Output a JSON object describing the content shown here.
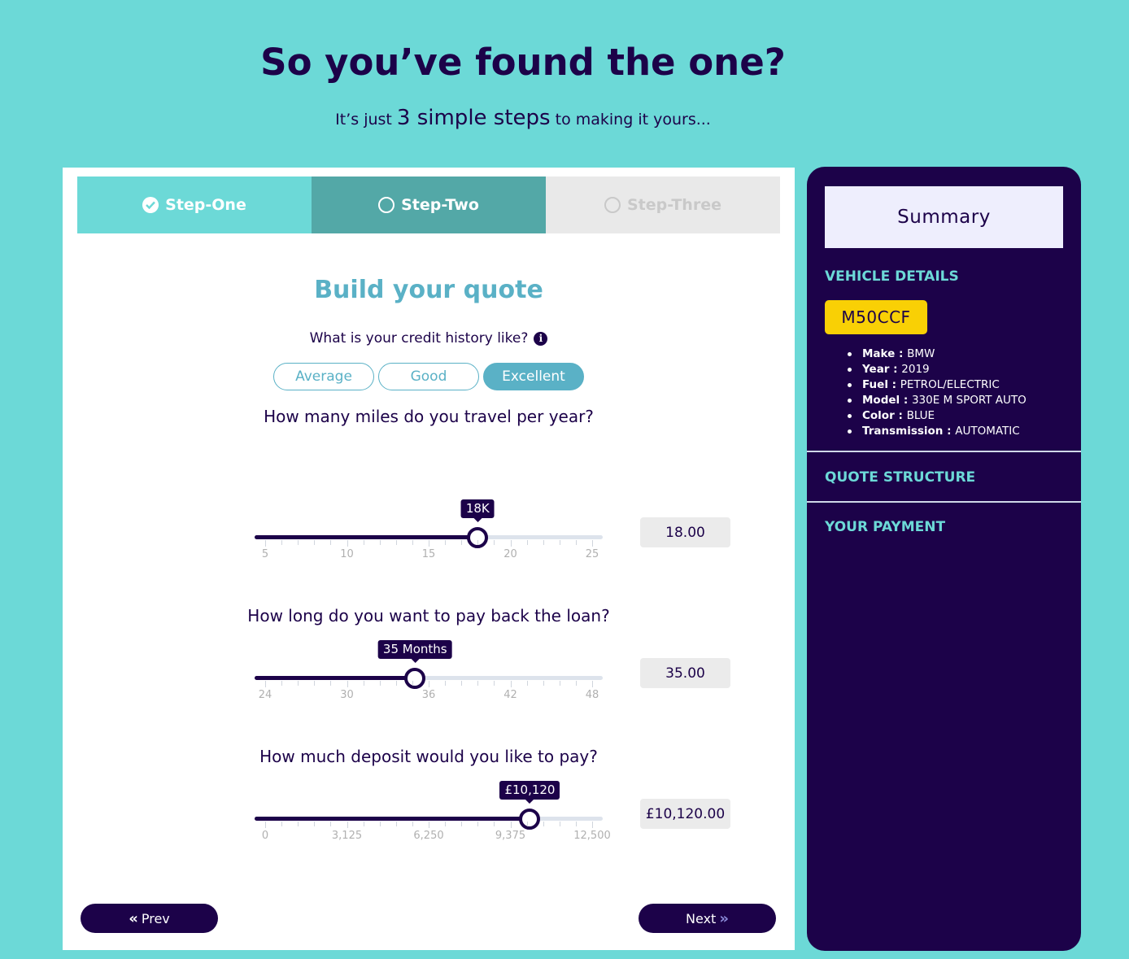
{
  "hero": {
    "title": "So you’ve found the one?",
    "sub_before": "It’s just ",
    "sub_highlight": "3 simple steps",
    "sub_after": " to making it yours..."
  },
  "steps": [
    {
      "label": "Step-One",
      "state": "complete"
    },
    {
      "label": "Step-Two",
      "state": "current"
    },
    {
      "label": "Step-Three",
      "state": "upcoming"
    }
  ],
  "form": {
    "title": "Build your quote",
    "credit_question": "What is your credit history like?",
    "credit_options": [
      "Average",
      "Good",
      "Excellent"
    ],
    "credit_selected": "Excellent"
  },
  "sliders": [
    {
      "question": "How many miles do you travel per year?",
      "min": 5,
      "max": 25,
      "value": 18,
      "thumb_label": "18K",
      "ticks": [
        "5",
        "10",
        "15",
        "20",
        "25"
      ],
      "value_box": "18.00"
    },
    {
      "question": "How long do you want to pay back the loan?",
      "min": 24,
      "max": 48,
      "value": 35,
      "thumb_label": "35 Months",
      "ticks": [
        "24",
        "30",
        "36",
        "42",
        "48"
      ],
      "value_box": "35.00"
    },
    {
      "question": "How much deposit would you like to pay?",
      "min": 0,
      "max": 12500,
      "value": 10120,
      "thumb_label": "£10,120",
      "ticks": [
        "0",
        "3,125",
        "6,250",
        "9,375",
        "12,500"
      ],
      "value_box": "£10,120.00"
    }
  ],
  "nav": {
    "prev": "Prev",
    "next": "Next"
  },
  "summary": {
    "title": "Summary",
    "vehicle_title": "VEHICLE DETAILS",
    "plate": "M50CCF",
    "details": [
      {
        "label": "Make",
        "value": "BMW"
      },
      {
        "label": "Year",
        "value": "2019"
      },
      {
        "label": "Fuel",
        "value": "PETROL/ELECTRIC"
      },
      {
        "label": "Model",
        "value": "330E M SPORT AUTO"
      },
      {
        "label": "Color",
        "value": "BLUE"
      },
      {
        "label": "Transmission",
        "value": "AUTOMATIC"
      }
    ],
    "quote_title": "QUOTE STRUCTURE",
    "payment_title": "YOUR PAYMENT"
  },
  "colors": {
    "background": "#6cd9d7",
    "navy": "#1c0249",
    "teal_accent": "#5ab1c6",
    "plate_yellow": "#f9d005"
  }
}
